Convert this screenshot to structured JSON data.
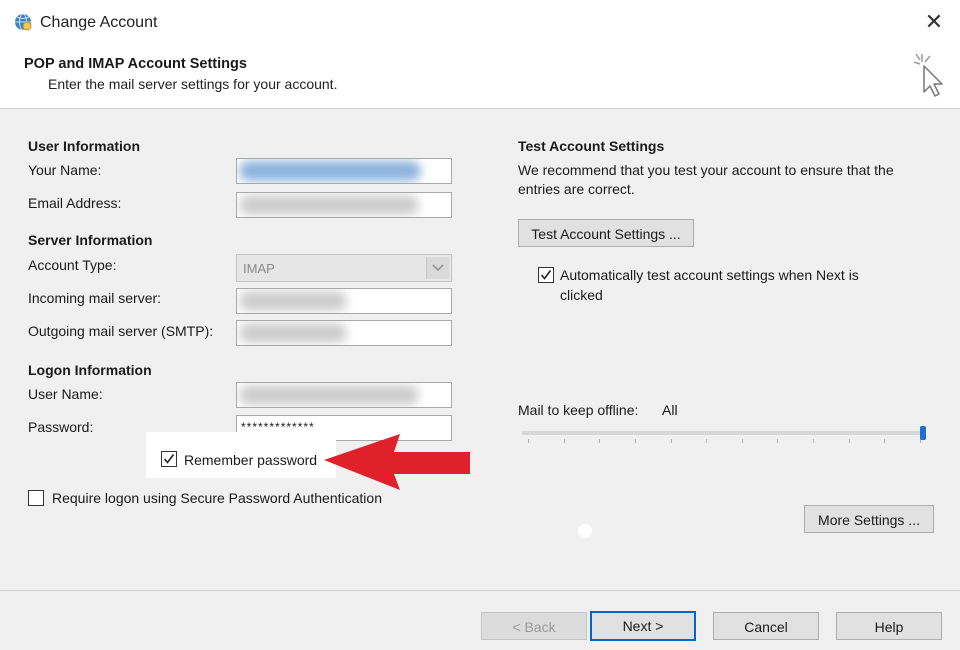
{
  "window": {
    "title": "Change Account",
    "close_glyph": "✕",
    "app_icon": "globe-mail-icon"
  },
  "header": {
    "title": "POP and IMAP Account Settings",
    "subtitle": "Enter the mail server settings for your account.",
    "icon": "wizard-cursor-icon"
  },
  "user_info": {
    "section": "User Information",
    "your_name_label": "Your Name:",
    "email_label": "Email Address:"
  },
  "server_info": {
    "section": "Server Information",
    "account_type_label": "Account Type:",
    "account_type_value": "IMAP",
    "incoming_label": "Incoming mail server:",
    "outgoing_label": "Outgoing mail server (SMTP):"
  },
  "logon_info": {
    "section": "Logon Information",
    "username_label": "User Name:",
    "password_label": "Password:",
    "password_value": "*************",
    "remember_label": "Remember password",
    "remember_checked": true,
    "spa_label": "Require logon using Secure Password Authentication",
    "spa_checked": false
  },
  "test": {
    "section": "Test Account Settings",
    "description_line1": "We recommend that you test your account to ensure that the",
    "description_line2": "entries are correct.",
    "button": "Test Account Settings ...",
    "auto_label_line1": "Automatically test account settings when Next is",
    "auto_label_line2": "clicked",
    "auto_checked": true
  },
  "offline": {
    "label": "Mail to keep offline:",
    "value": "All",
    "slider_level": 1.0
  },
  "buttons": {
    "more_settings": "More Settings ...",
    "back": "< Back",
    "next": "Next >",
    "cancel": "Cancel",
    "help": "Help"
  },
  "colors": {
    "annotation_arrow": "#e0202a",
    "primary_border": "#0a64c8",
    "slider_thumb": "#1e6fd0"
  }
}
